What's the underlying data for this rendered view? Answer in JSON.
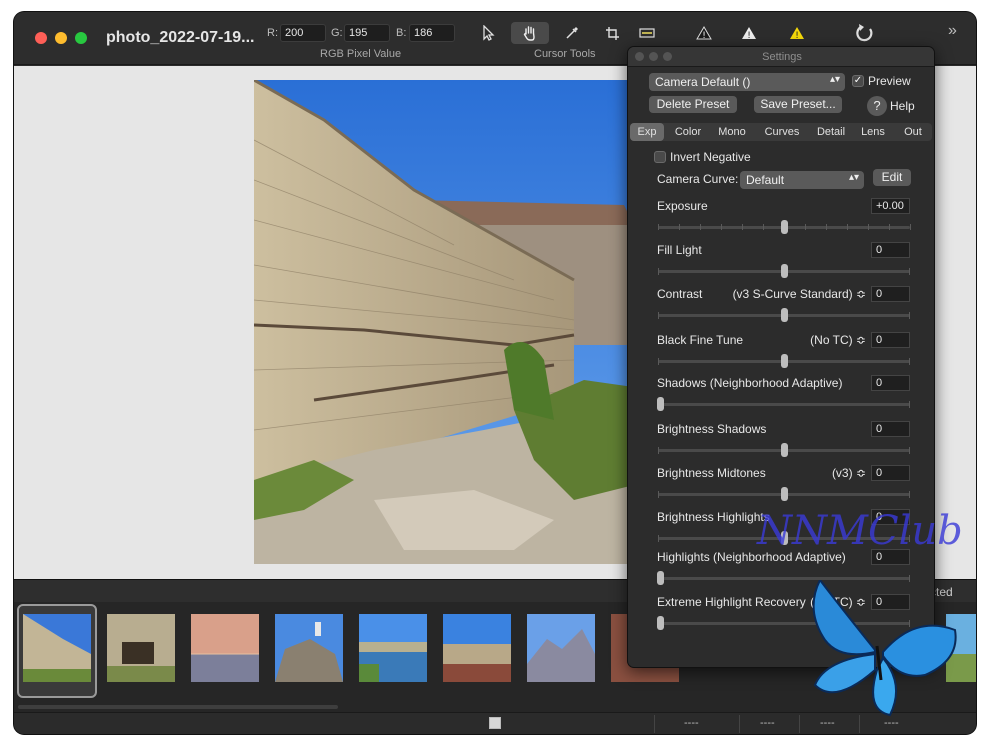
{
  "window": {
    "title": "photo_2022-07-19..."
  },
  "toolbar": {
    "rgb": {
      "r_label": "R:",
      "r": "200",
      "g_label": "G:",
      "g": "195",
      "b_label": "B:",
      "b": "186",
      "caption": "RGB Pixel Value"
    },
    "cursor_tools_caption": "Cursor Tools",
    "tools": [
      "arrow-cursor-icon",
      "hand-icon",
      "eyedropper-icon",
      "crop-icon",
      "straighten-icon",
      "warning-outline-icon",
      "warning-icon",
      "warning-yellow-icon",
      "rotate-icon"
    ],
    "overflow": "»"
  },
  "settings": {
    "title": "Settings",
    "preset": "Camera Default ()",
    "preview_label": "Preview",
    "preview_checked": true,
    "delete_preset": "Delete Preset",
    "save_preset": "Save Preset...",
    "help_symbol": "?",
    "help_label": "Help",
    "tabs": [
      "Exp",
      "Color",
      "Mono",
      "Curves",
      "Detail",
      "Lens",
      "Out"
    ],
    "active_tab": "Exp",
    "invert_negative": "Invert Negative",
    "camera_curve_label": "Camera Curve:",
    "camera_curve_value": "Default",
    "edit_label": "Edit",
    "sliders": [
      {
        "label": "Exposure",
        "value": "+0.00",
        "mode": "",
        "position": 0.5
      },
      {
        "label": "Fill Light",
        "value": "0",
        "mode": "",
        "position": 0.5
      },
      {
        "label": "Contrast",
        "value": "0",
        "mode": "(v3 S-Curve Standard) ≎",
        "position": 0.5
      },
      {
        "label": "Black Fine Tune",
        "value": "0",
        "mode": "(No TC) ≎",
        "position": 0.5
      },
      {
        "label": "Shadows (Neighborhood Adaptive)",
        "value": "0",
        "mode": "",
        "position": 0.0
      },
      {
        "label": "Brightness Shadows",
        "value": "0",
        "mode": "",
        "position": 0.5
      },
      {
        "label": "Brightness Midtones",
        "value": "0",
        "mode": "(v3) ≎",
        "position": 0.5
      },
      {
        "label": "Brightness Highlights",
        "value": "0",
        "mode": "",
        "position": 0.5
      },
      {
        "label": "Highlights (Neighborhood Adaptive)",
        "value": "0",
        "mode": "",
        "position": 0.0
      },
      {
        "label": "Extreme Highlight Recovery",
        "value": "0",
        "mode": "(No TC) ≎",
        "position": 0.0
      }
    ]
  },
  "filmstrip": {
    "partial_label": "cted",
    "count": 12
  },
  "statusbar": {
    "cells": [
      "----",
      "----",
      "----",
      "----"
    ]
  },
  "watermark": "NNMClub"
}
